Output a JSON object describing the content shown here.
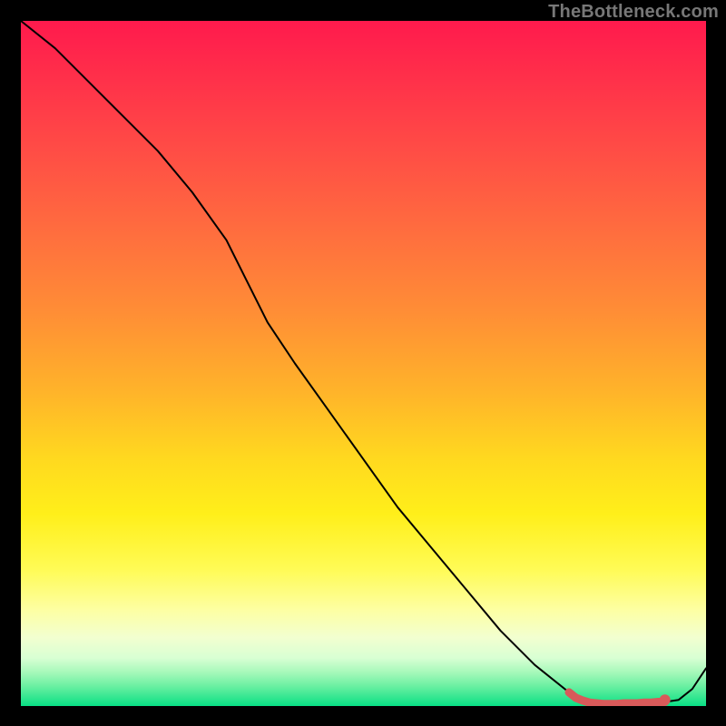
{
  "watermark": "TheBottleneck.com",
  "chart_data": {
    "type": "line",
    "title": "",
    "xlabel": "",
    "ylabel": "",
    "xlim": [
      0,
      100
    ],
    "ylim": [
      0,
      100
    ],
    "grid": false,
    "series": [
      {
        "name": "curve",
        "color": "#000000",
        "x": [
          0,
          5,
          10,
          15,
          20,
          25,
          30,
          33,
          36,
          40,
          45,
          50,
          55,
          60,
          65,
          70,
          75,
          80,
          82,
          84,
          86,
          88,
          90,
          92,
          94,
          96,
          98,
          100
        ],
        "y": [
          100,
          96,
          91,
          86,
          81,
          75,
          68,
          62,
          56,
          50,
          43,
          36,
          29,
          23,
          17,
          11,
          6,
          2,
          0.8,
          0.4,
          0.3,
          0.4,
          0.4,
          0.5,
          0.6,
          0.9,
          2.5,
          5.5
        ]
      },
      {
        "name": "highlight",
        "color": "#d85a5a",
        "x": [
          80,
          81,
          82,
          83,
          84,
          85,
          86,
          87,
          88,
          89,
          90,
          91,
          92,
          93,
          94
        ],
        "y": [
          2.0,
          1.2,
          0.8,
          0.5,
          0.4,
          0.3,
          0.3,
          0.3,
          0.4,
          0.4,
          0.4,
          0.5,
          0.5,
          0.6,
          0.6
        ]
      }
    ],
    "markers": [
      {
        "x": 94,
        "y": 0.9,
        "color": "#d85a5a",
        "r": 6
      }
    ]
  }
}
